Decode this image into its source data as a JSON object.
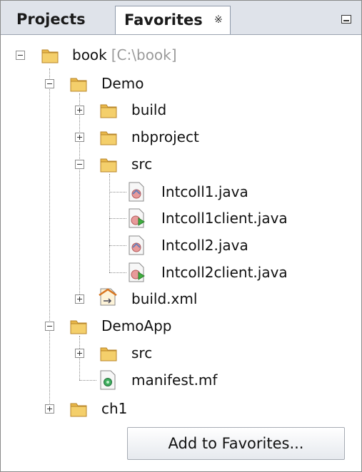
{
  "tabs": [
    {
      "label": "Projects",
      "active": false
    },
    {
      "label": "Favorites",
      "active": true,
      "close_glyph": "x"
    }
  ],
  "tree": [
    {
      "label": "book",
      "hint": "[C:\\book]",
      "icon": "folder-icon",
      "expander": "minus"
    },
    {
      "label": "Demo",
      "icon": "folder-icon",
      "expander": "minus"
    },
    {
      "label": "build",
      "icon": "folder-icon",
      "expander": "plus"
    },
    {
      "label": "nbproject",
      "icon": "folder-icon",
      "expander": "plus"
    },
    {
      "label": "src",
      "icon": "folder-icon",
      "expander": "minus"
    },
    {
      "label": "Intcoll1.java",
      "icon": "java-class-icon"
    },
    {
      "label": "Intcoll1client.java",
      "icon": "java-main-class-icon"
    },
    {
      "label": "Intcoll2.java",
      "icon": "java-class-icon"
    },
    {
      "label": "Intcoll2client.java",
      "icon": "java-main-class-icon"
    },
    {
      "label": "build.xml",
      "icon": "ant-script-icon",
      "expander": "plus"
    },
    {
      "label": "DemoApp",
      "icon": "folder-icon",
      "expander": "minus"
    },
    {
      "label": "src",
      "icon": "folder-icon",
      "expander": "plus"
    },
    {
      "label": "manifest.mf",
      "icon": "manifest-file-icon"
    },
    {
      "label": "ch1",
      "icon": "folder-icon",
      "expander": "plus"
    }
  ],
  "add_button": {
    "label": "Add to Favorites..."
  },
  "colors": {
    "folder": "#e9b84a",
    "tab_bar": "#dfe3ea",
    "muted_text": "#9a9a9a"
  }
}
